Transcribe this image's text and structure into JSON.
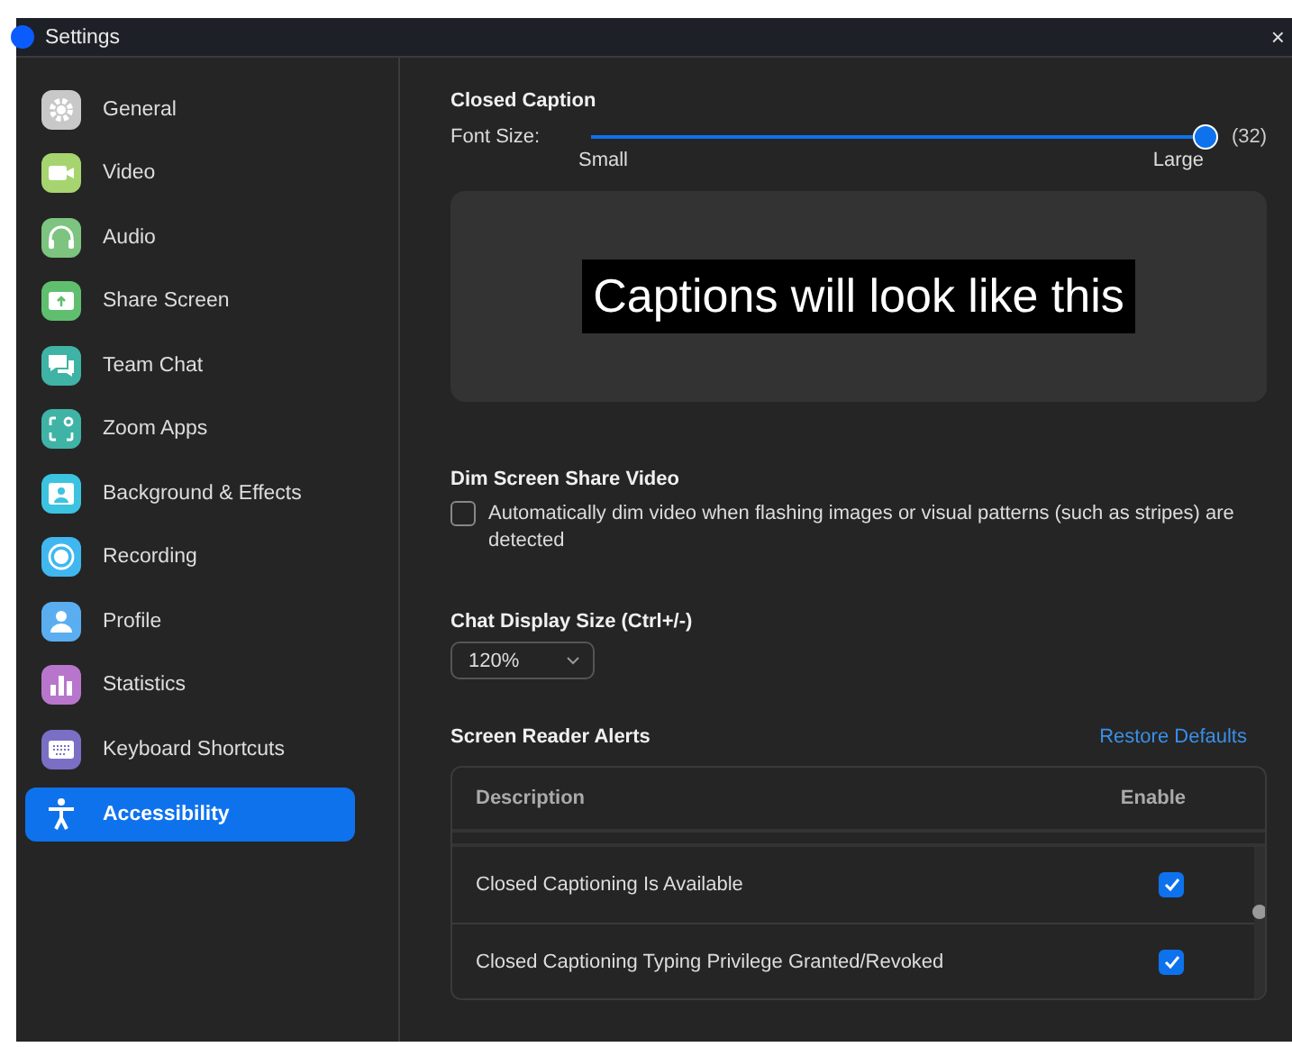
{
  "window": {
    "title": "Settings",
    "close": "×"
  },
  "sidebar": {
    "items": [
      {
        "label": "General",
        "selected": false
      },
      {
        "label": "Video",
        "selected": false
      },
      {
        "label": "Audio",
        "selected": false
      },
      {
        "label": "Share Screen",
        "selected": false
      },
      {
        "label": "Team Chat",
        "selected": false
      },
      {
        "label": "Zoom Apps",
        "selected": false
      },
      {
        "label": "Background & Effects",
        "selected": false
      },
      {
        "label": "Recording",
        "selected": false
      },
      {
        "label": "Profile",
        "selected": false
      },
      {
        "label": "Statistics",
        "selected": false
      },
      {
        "label": "Keyboard Shortcuts",
        "selected": false
      },
      {
        "label": "Accessibility",
        "selected": true
      }
    ]
  },
  "closed_caption": {
    "title": "Closed Caption",
    "font_size": {
      "label": "Font Size:",
      "level": 1,
      "reading": "(32)",
      "min_label": "Small",
      "max_label": "Large"
    },
    "preview": "Captions will look like this"
  },
  "dim_screen_share": {
    "title": "Dim Screen Share Video",
    "checkbox": {
      "label": "Automatically dim video when flashing images or visual patterns (such as stripes) are detected",
      "checked": false
    }
  },
  "chat_display_size": {
    "title": "Chat Display Size (Ctrl+/-)",
    "value": "120%"
  },
  "screen_reader_alerts": {
    "title": "Screen Reader Alerts",
    "restore": "Restore Defaults",
    "columns": [
      "Description",
      "Enable"
    ],
    "rows": [
      {
        "description": "Closed Captioning Is Available",
        "checked": true
      },
      {
        "description": "Closed Captioning Typing Privilege Granted/Revoked",
        "checked": true
      }
    ]
  }
}
